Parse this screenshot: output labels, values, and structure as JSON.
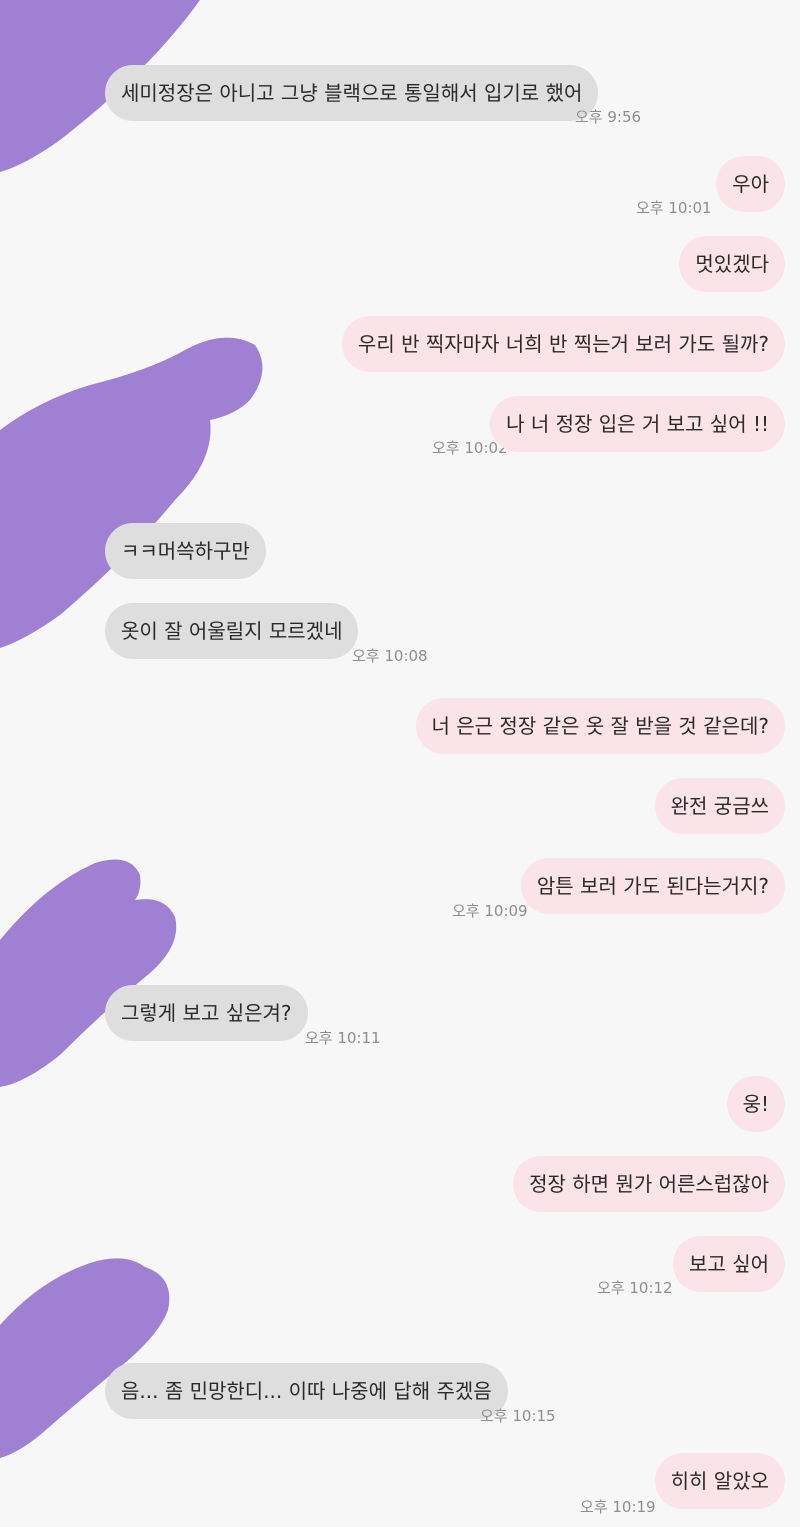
{
  "colors": {
    "background": "#f7f7f7",
    "incoming_bubble": "#dedede",
    "outgoing_bubble": "#fbe3ea",
    "avatar_redaction": "#a080d3",
    "timestamp": "#8e8e8e"
  },
  "messages": [
    {
      "dir": "in",
      "text": "세미정장은 아니고 그냥 블랙으로 통일해서 입기로 했어",
      "time": "오후 9:56"
    },
    {
      "dir": "out",
      "text": "우아",
      "time": "오후 10:01"
    },
    {
      "dir": "out",
      "text": "멋있겠다",
      "time": ""
    },
    {
      "dir": "out",
      "text": "우리 반 찍자마자 너희 반 찍는거 보러 가도 될까?",
      "time": ""
    },
    {
      "dir": "out",
      "text": "나 너 정장 입은 거 보고 싶어 !!",
      "time": "오후 10:02"
    },
    {
      "dir": "in",
      "text": "ㅋㅋ머쓱하구만",
      "time": ""
    },
    {
      "dir": "in",
      "text": "옷이 잘 어울릴지 모르겠네",
      "time": "오후 10:08"
    },
    {
      "dir": "out",
      "text": "너 은근 정장 같은 옷 잘 받을 것 같은데?",
      "time": ""
    },
    {
      "dir": "out",
      "text": "완전 궁금쓰",
      "time": ""
    },
    {
      "dir": "out",
      "text": "암튼 보러 가도 된다는거지?",
      "time": "오후 10:09"
    },
    {
      "dir": "in",
      "text": "그렇게 보고 싶은겨?",
      "time": "오후 10:11"
    },
    {
      "dir": "out",
      "text": "웅!",
      "time": ""
    },
    {
      "dir": "out",
      "text": "정장 하면 뭔가 어른스럽잖아",
      "time": ""
    },
    {
      "dir": "out",
      "text": "보고 싶어",
      "time": "오후 10:12"
    },
    {
      "dir": "in",
      "text": "음... 좀 민망한디... 이따 나중에 답해 주겠음",
      "time": "오후 10:15"
    },
    {
      "dir": "out",
      "text": "히히 알았오",
      "time": "오후 10:19"
    }
  ]
}
